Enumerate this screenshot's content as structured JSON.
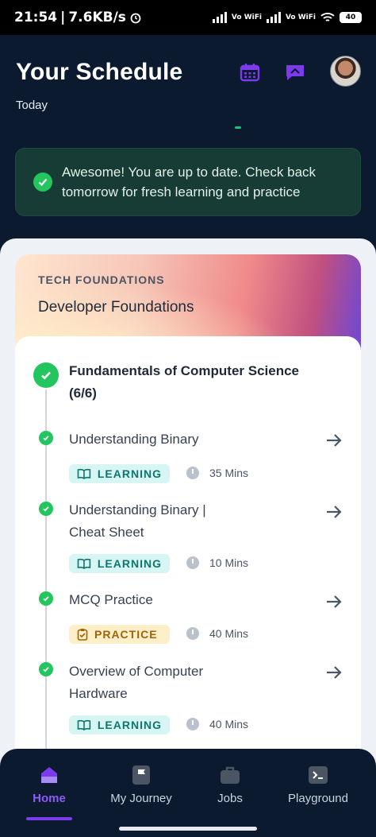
{
  "status_bar": {
    "time": "21:54",
    "network_speed": "7.6KB/s",
    "carrier_tag_1": "Vo WiFi",
    "carrier_tag_2": "Vo WiFi",
    "battery": "40"
  },
  "header": {
    "title": "Your Schedule",
    "subtitle": "Today",
    "icons": [
      "calendar-icon",
      "chat-icon",
      "avatar"
    ]
  },
  "alert": {
    "message": "Awesome! You are up to date. Check back tomorrow for fresh learning and practice"
  },
  "course": {
    "tag": "TECH FOUNDATIONS",
    "title": "Developer Foundations",
    "module": {
      "title": "Fundamentals of Computer Science (6/6)",
      "items": [
        {
          "title": "Understanding Binary",
          "type": "LEARNING",
          "duration": "35 Mins"
        },
        {
          "title": "Understanding Binary | Cheat Sheet",
          "type": "LEARNING",
          "duration": "10 Mins"
        },
        {
          "title": "MCQ Practice",
          "type": "PRACTICE",
          "duration": "40 Mins"
        },
        {
          "title": "Overview of Computer Hardware",
          "type": "LEARNING",
          "duration": "40 Mins"
        }
      ]
    }
  },
  "bottom_nav": {
    "items": [
      {
        "label": "Home",
        "icon": "home-icon",
        "active": true
      },
      {
        "label": "My Journey",
        "icon": "flag-icon",
        "active": false
      },
      {
        "label": "Jobs",
        "icon": "briefcase-icon",
        "active": false
      },
      {
        "label": "Playground",
        "icon": "terminal-icon",
        "active": false
      }
    ]
  },
  "colors": {
    "background": "#0b1a2e",
    "accent": "#7c3aed",
    "success": "#22c55e",
    "learning_badge": "#d6f5f3",
    "practice_badge": "#fdf0c8"
  }
}
